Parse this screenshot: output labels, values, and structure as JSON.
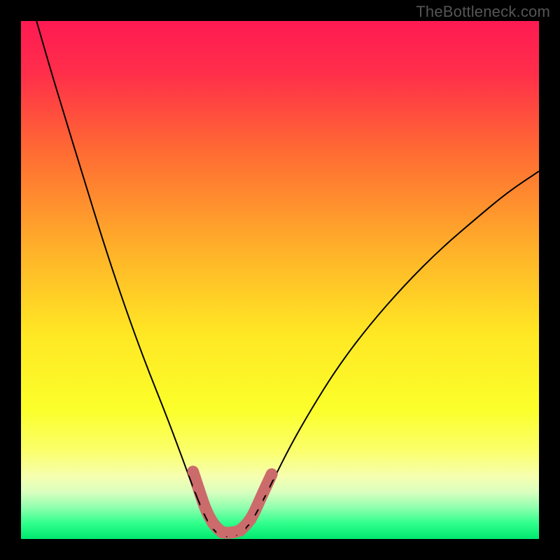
{
  "watermark": "TheBottleneck.com",
  "chart_data": {
    "type": "line",
    "title": "",
    "xlabel": "",
    "ylabel": "",
    "xrange": [
      0,
      100
    ],
    "yrange": [
      0,
      100
    ],
    "background_gradient": {
      "stops": [
        {
          "offset": 0.0,
          "color": "#ff1a53"
        },
        {
          "offset": 0.1,
          "color": "#ff2e4a"
        },
        {
          "offset": 0.25,
          "color": "#ff6a33"
        },
        {
          "offset": 0.45,
          "color": "#ffb429"
        },
        {
          "offset": 0.6,
          "color": "#ffe624"
        },
        {
          "offset": 0.75,
          "color": "#fbff2a"
        },
        {
          "offset": 0.83,
          "color": "#fbff6b"
        },
        {
          "offset": 0.88,
          "color": "#f5ffb0"
        },
        {
          "offset": 0.91,
          "color": "#d9ffbf"
        },
        {
          "offset": 0.94,
          "color": "#8dffad"
        },
        {
          "offset": 0.97,
          "color": "#2fff8b"
        },
        {
          "offset": 1.0,
          "color": "#00e86f"
        }
      ]
    },
    "series": [
      {
        "name": "left-curve",
        "type": "line",
        "color": "#000000",
        "stroke_width": 2,
        "points": [
          {
            "x": 3.0,
            "y": 100.0
          },
          {
            "x": 5.0,
            "y": 93.0
          },
          {
            "x": 8.0,
            "y": 83.0
          },
          {
            "x": 12.0,
            "y": 70.0
          },
          {
            "x": 16.0,
            "y": 57.0
          },
          {
            "x": 20.0,
            "y": 45.0
          },
          {
            "x": 24.0,
            "y": 34.0
          },
          {
            "x": 28.0,
            "y": 24.0
          },
          {
            "x": 31.0,
            "y": 16.0
          },
          {
            "x": 33.0,
            "y": 10.5
          },
          {
            "x": 35.0,
            "y": 5.5
          },
          {
            "x": 36.5,
            "y": 2.5
          },
          {
            "x": 38.5,
            "y": 0.5
          },
          {
            "x": 41.5,
            "y": 0.5
          },
          {
            "x": 43.5,
            "y": 2.0
          }
        ]
      },
      {
        "name": "right-curve",
        "type": "line",
        "color": "#000000",
        "stroke_width": 2,
        "points": [
          {
            "x": 38.5,
            "y": 0.5
          },
          {
            "x": 41.5,
            "y": 0.5
          },
          {
            "x": 44.0,
            "y": 2.5
          },
          {
            "x": 46.0,
            "y": 6.0
          },
          {
            "x": 48.5,
            "y": 11.0
          },
          {
            "x": 52.0,
            "y": 18.0
          },
          {
            "x": 56.0,
            "y": 25.0
          },
          {
            "x": 61.0,
            "y": 33.0
          },
          {
            "x": 67.0,
            "y": 41.0
          },
          {
            "x": 74.0,
            "y": 49.0
          },
          {
            "x": 81.0,
            "y": 56.0
          },
          {
            "x": 88.0,
            "y": 62.0
          },
          {
            "x": 94.0,
            "y": 67.0
          },
          {
            "x": 100.0,
            "y": 71.0
          }
        ]
      },
      {
        "name": "marker-dots",
        "type": "scatter",
        "color": "#cc6b6b",
        "radius": 8,
        "points": [
          {
            "x": 33.2,
            "y": 13.0
          },
          {
            "x": 34.2,
            "y": 10.0
          },
          {
            "x": 35.5,
            "y": 6.0
          },
          {
            "x": 37.0,
            "y": 3.0
          },
          {
            "x": 38.8,
            "y": 1.2
          },
          {
            "x": 40.6,
            "y": 1.2
          },
          {
            "x": 42.4,
            "y": 1.6
          },
          {
            "x": 44.4,
            "y": 3.8
          },
          {
            "x": 45.8,
            "y": 6.8
          },
          {
            "x": 47.0,
            "y": 9.5
          },
          {
            "x": 48.4,
            "y": 12.5
          }
        ]
      },
      {
        "name": "marker-sausage",
        "type": "line",
        "color": "#cc6b6b",
        "stroke_width": 17,
        "linecap": "round",
        "points": [
          {
            "x": 33.2,
            "y": 13.0
          },
          {
            "x": 34.2,
            "y": 10.0
          },
          {
            "x": 35.5,
            "y": 6.0
          },
          {
            "x": 37.0,
            "y": 3.0
          },
          {
            "x": 38.8,
            "y": 1.2
          },
          {
            "x": 40.6,
            "y": 1.2
          },
          {
            "x": 42.4,
            "y": 1.6
          },
          {
            "x": 44.4,
            "y": 3.8
          },
          {
            "x": 45.8,
            "y": 6.8
          },
          {
            "x": 47.0,
            "y": 9.5
          },
          {
            "x": 48.4,
            "y": 12.5
          }
        ]
      }
    ]
  }
}
